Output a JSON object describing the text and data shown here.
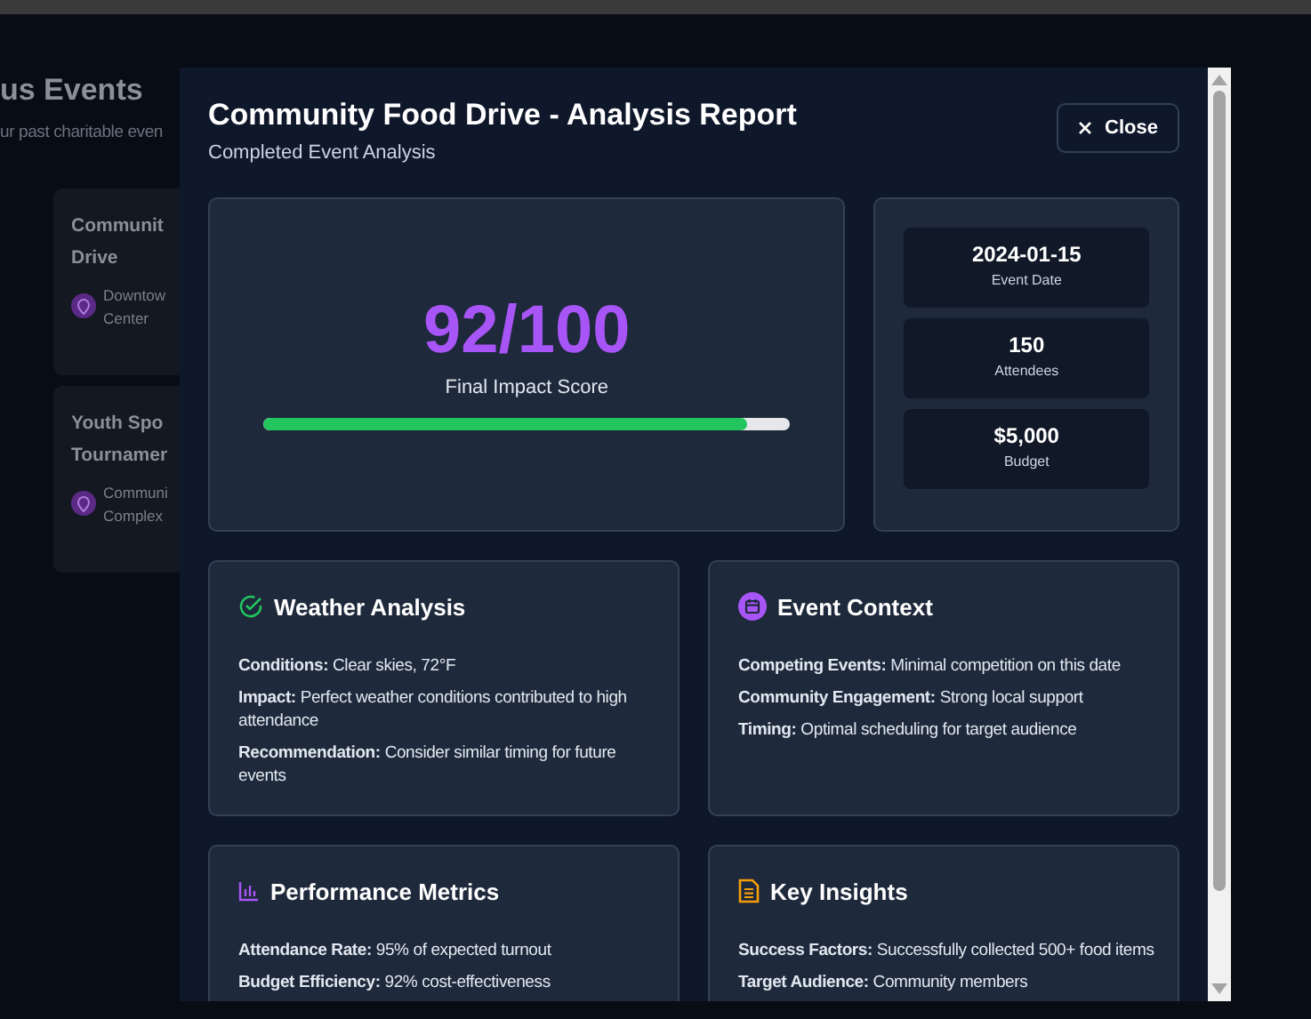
{
  "background_page": {
    "heading": "us Events",
    "subtitle": "ur past charitable even",
    "events": [
      {
        "title_lines": [
          "Communit",
          "Drive"
        ],
        "location_lines": [
          "Downtow",
          "Center"
        ]
      },
      {
        "title_lines": [
          "Youth Spo",
          "Tournamer"
        ],
        "location_lines": [
          "Communi",
          "Complex"
        ]
      }
    ]
  },
  "modal": {
    "title": "Community Food Drive - Analysis Report",
    "subtitle": "Completed Event Analysis",
    "close_button": "Close",
    "score": {
      "value": "92/100",
      "label": "Final Impact Score",
      "level": 0.92
    },
    "stats": [
      {
        "value": "2024-01-15",
        "label": "Event Date"
      },
      {
        "value": "150",
        "label": "Attendees"
      },
      {
        "value": "$5,000",
        "label": "Budget"
      }
    ],
    "sections": [
      {
        "kind": "check",
        "title": "Weather Analysis",
        "lines": [
          "**Conditions:** Clear skies, 72°F",
          "**Impact:** Perfect weather conditions contributed to high attendance",
          "**Recommendation:** Consider similar timing for future events"
        ]
      },
      {
        "kind": "calendar",
        "title": "Event Context",
        "lines": [
          "**Competing Events:** Minimal competition on this date",
          "**Community Engagement:** Strong local support",
          "**Timing:** Optimal scheduling for target audience"
        ]
      },
      {
        "kind": "chart",
        "title": "Performance Metrics",
        "lines": [
          "**Attendance Rate:** 95% of expected turnout",
          "**Budget Efficiency:** 92% cost-effectiveness"
        ]
      },
      {
        "kind": "document",
        "title": "Key Insights",
        "lines": [
          "**Success Factors:** Successfully collected 500+ food items",
          "**Target Audience:** Community members"
        ]
      }
    ]
  }
}
